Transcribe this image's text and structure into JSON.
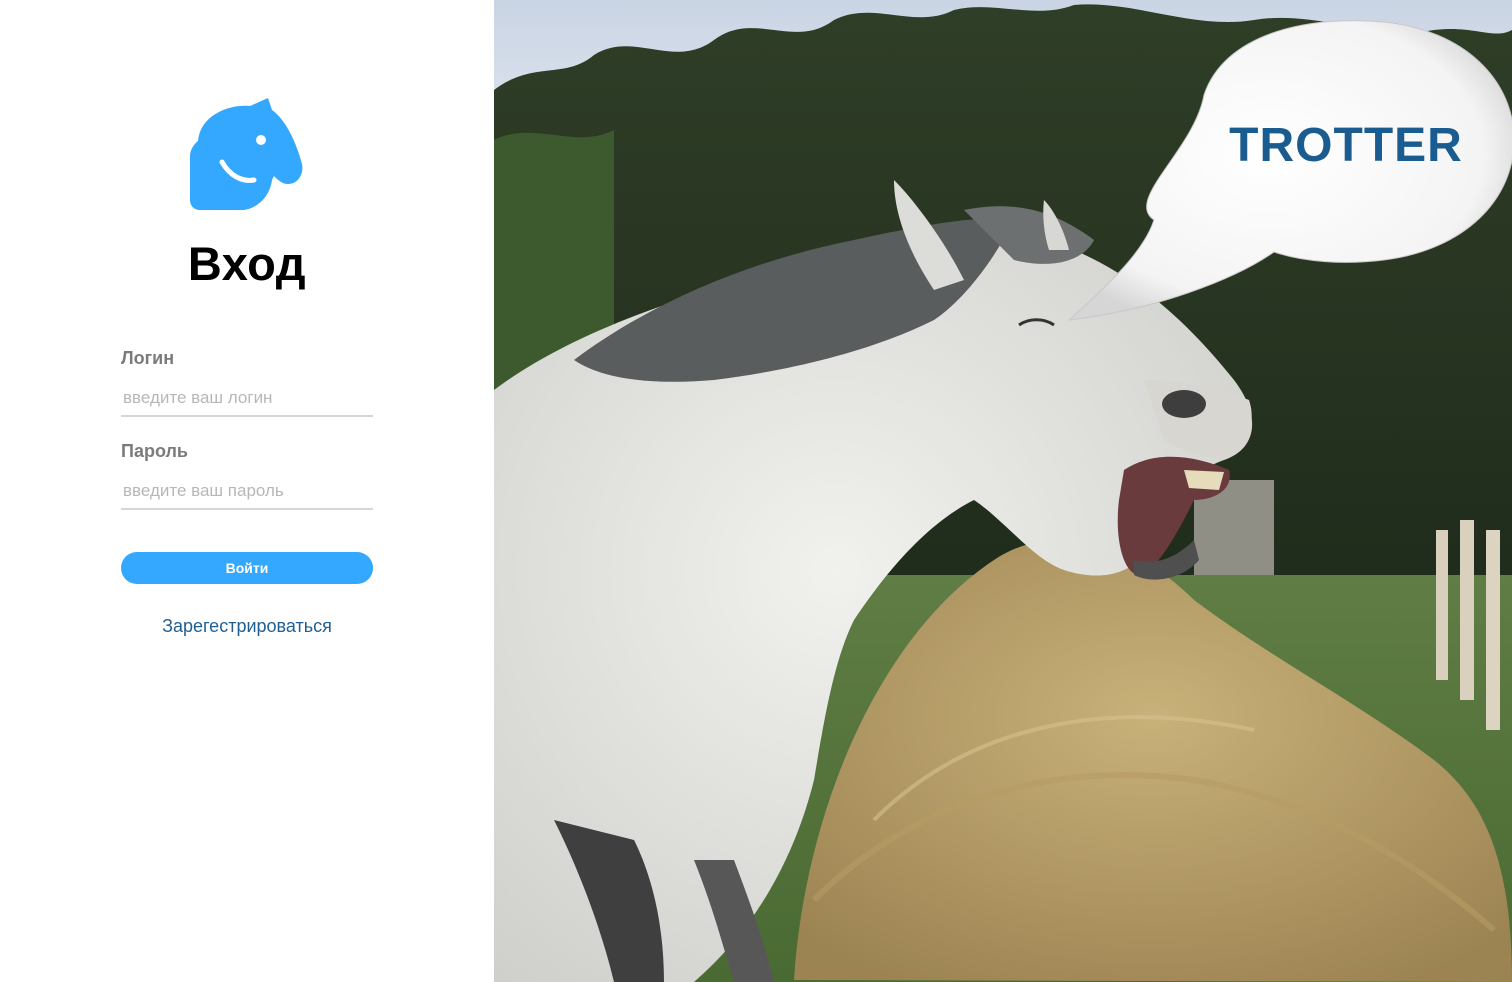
{
  "login": {
    "title": "Вход",
    "login_label": "Логин",
    "login_placeholder": "введите ваш логин",
    "password_label": "Пароль",
    "password_placeholder": "введите ваш пароль",
    "submit_label": "Войти",
    "register_label": "Зарегестрироваться"
  },
  "hero": {
    "bubble_text": "TROTTER"
  },
  "colors": {
    "accent": "#34a7ff",
    "link": "#1f5f93",
    "bubble_text": "#1a5c8f"
  },
  "icons": {
    "logo": "horse-head-icon"
  }
}
